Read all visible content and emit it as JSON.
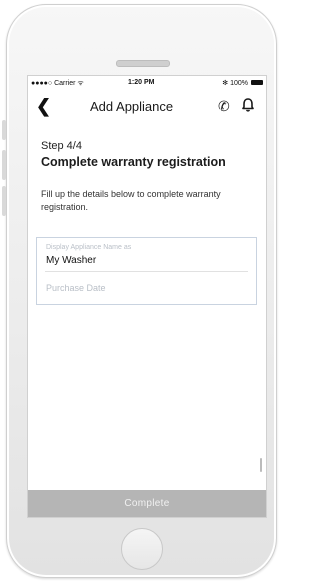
{
  "status_bar": {
    "carrier": "●●●●○ Carrier ᯤ",
    "time": "1:20 PM",
    "battery": "✻ 100%"
  },
  "nav": {
    "back_icon": "chevron-left",
    "title": "Add Appliance",
    "phone_icon": "phone",
    "bell_icon": "bell"
  },
  "content": {
    "step": "Step 4/4",
    "heading": "Complete warranty registration",
    "description": "Fill up the details below to complete warranty registration."
  },
  "form": {
    "display_name_label": "Display Appliance Name as",
    "display_name_value": "My Washer",
    "purchase_date_placeholder": "Purchase Date"
  },
  "footer": {
    "complete_label": "Complete"
  },
  "colors": {
    "complete_button_bg": "#b5b5b5",
    "field_border": "#c9d3e0",
    "placeholder": "#b9bfc7"
  }
}
